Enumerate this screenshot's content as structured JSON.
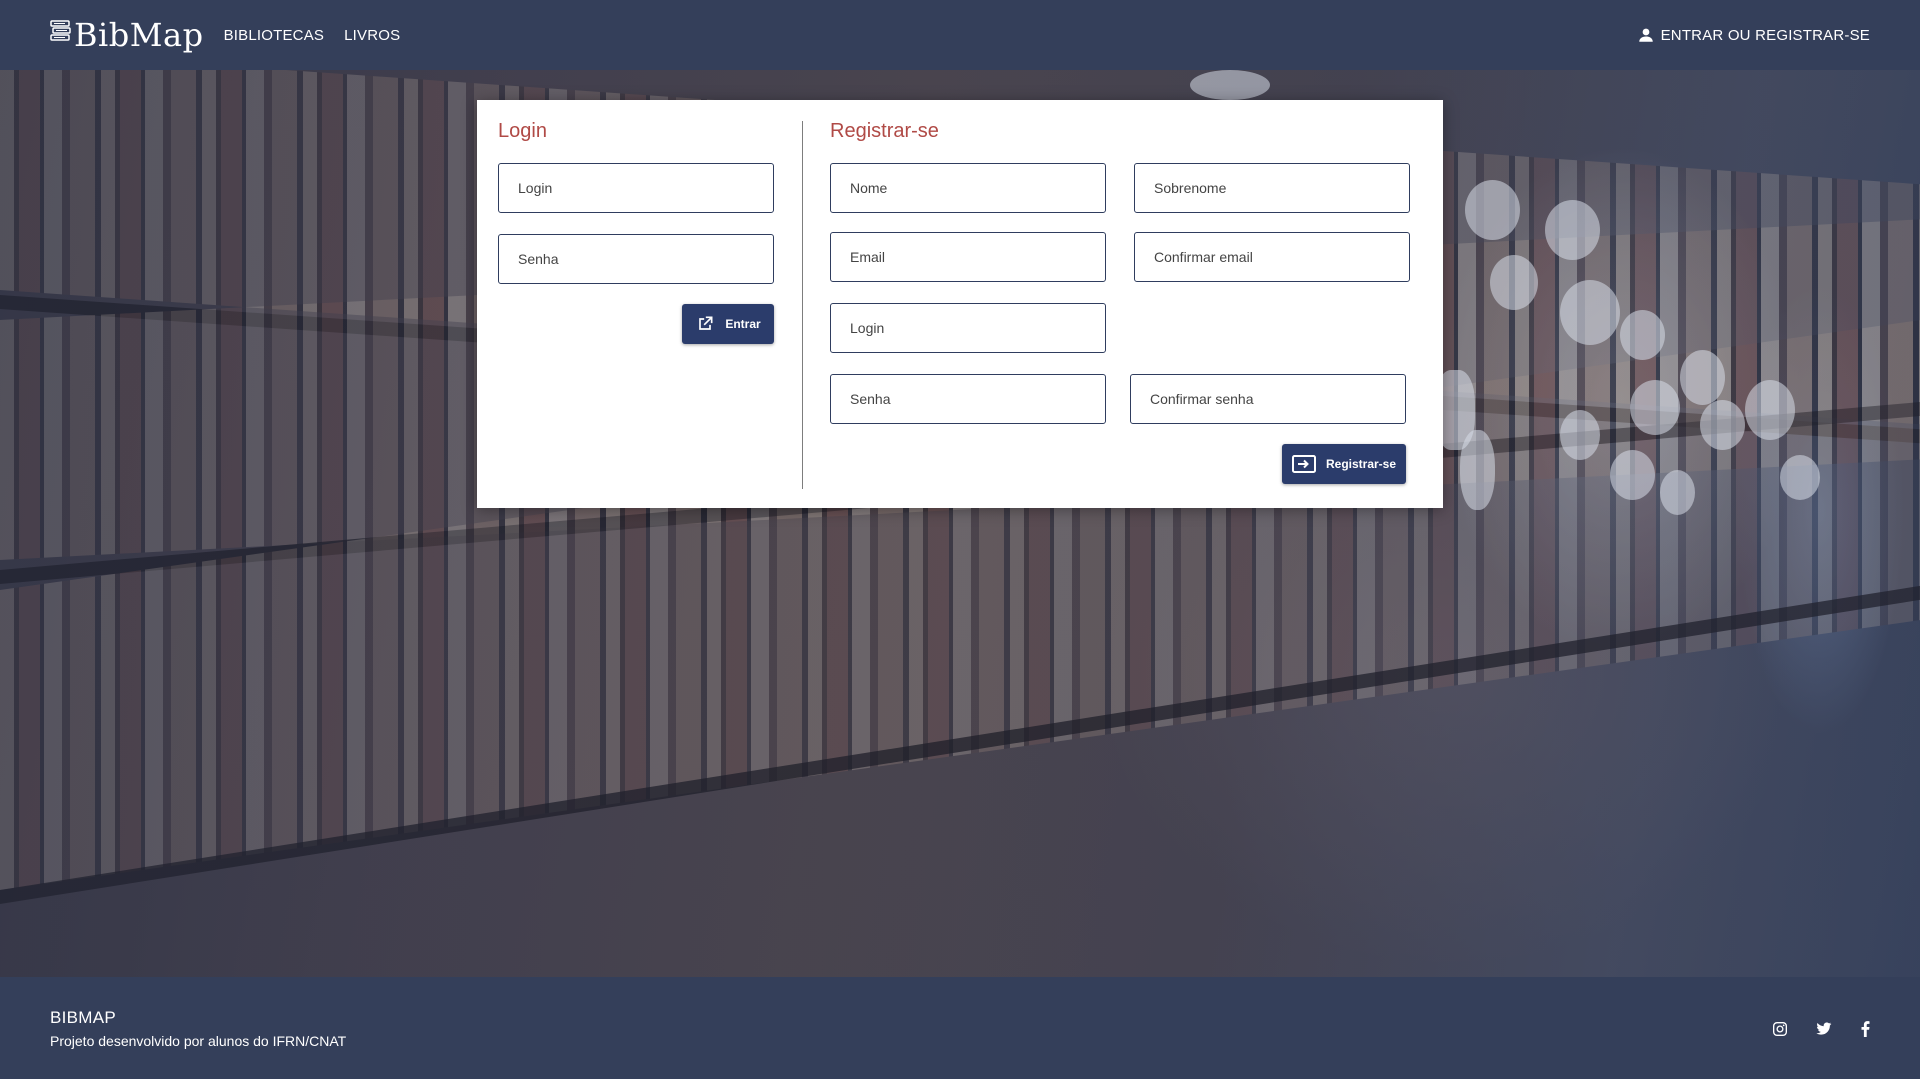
{
  "header": {
    "brand": "BibMap",
    "nav": [
      {
        "label": "BIBLIOTECAS"
      },
      {
        "label": "LIVROS"
      }
    ],
    "account_label": "ENTRAR OU REGISTRAR-SE"
  },
  "login": {
    "title": "Login",
    "login_placeholder": "Login",
    "password_placeholder": "Senha",
    "submit_label": "Entrar"
  },
  "register": {
    "title": "Registrar-se",
    "first_name_placeholder": "Nome",
    "last_name_placeholder": "Sobrenome",
    "email_placeholder": "Email",
    "confirm_email_placeholder": "Confirmar email",
    "login_placeholder": "Login",
    "password_placeholder": "Senha",
    "confirm_password_placeholder": "Confirmar senha",
    "submit_label": "Registrar-se"
  },
  "footer": {
    "title": "BIBMAP",
    "subtitle": "Projeto desenvolvido por alunos do IFRN/CNAT",
    "social_icons": [
      "instagram-icon",
      "twitter-icon",
      "facebook-icon"
    ]
  },
  "colors": {
    "header_bg": "#343f5a",
    "accent_title": "#b04a46",
    "button_bg": "#2b3c6b",
    "field_border": "#2f3d5e"
  }
}
